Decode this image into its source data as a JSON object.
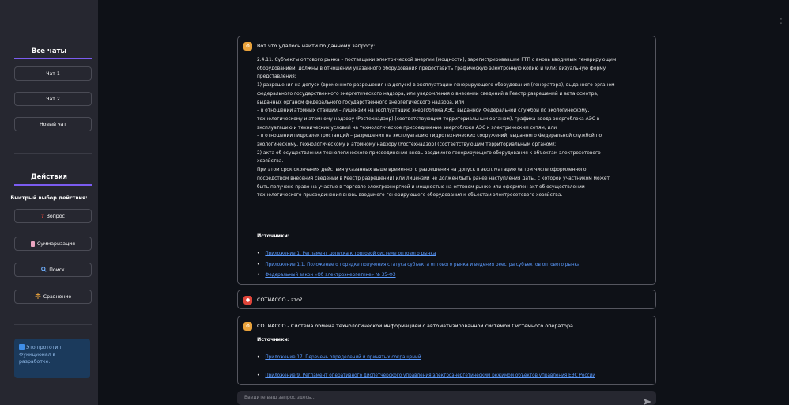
{
  "sidebar": {
    "chats_header": "Все чаты",
    "chats": [
      "Чат 1",
      "Чат 2",
      "Новый чат"
    ],
    "actions_header": "Действия",
    "quick_label": "Быстрый выбор действия:",
    "actions": [
      {
        "icon": "question-icon",
        "label": "Вопрос"
      },
      {
        "icon": "document-icon",
        "label": "Суммаризация"
      },
      {
        "icon": "search-icon",
        "label": "Поиск"
      },
      {
        "icon": "compare-icon",
        "label": "Сравнение"
      }
    ],
    "info": "Это прототип. Функционал в разработке."
  },
  "messages": [
    {
      "role": "assistant",
      "lead": "Вот что удалось найти по данному запросу:",
      "lines": [
        "2.4.11. Субъекты оптового рынка – поставщики электрической энергии (мощности), зарегистрировавшие ГТП с вновь вводимым генерирующим",
        "оборудованием, должны в отношении указанного оборудования предоставить графическую электронную копию и (или) визуальную форму",
        "представления:",
        "1) разрешения на допуск (временного разрешения на допуск) в эксплуатацию генерирующего оборудования (генератора), выданного органом",
        "федерального государственного энергетического надзора, или уведомления о внесении сведений в Реестр разрешений и акта осмотра,",
        "выданных органом федерального государственного энергетического надзора, или",
        "– в отношении атомных станций – лицензии на эксплуатацию энергоблока АЭС, выданной Федеральной службой по экологическому,",
        "технологическому и атомному надзору (Ростехнадзор) (соответствующим территориальным органом), графика ввода энергоблока АЭС в",
        "эксплуатацию и технических условий на технологическое присоединение энергоблока АЭС к электрическим сетям, или",
        "– в отношении гидроэлектростанций – разрешения на эксплуатацию гидротехнических сооружений, выданного Федеральной службой по",
        "экологическому, технологическому и атомному надзору (Ростехнадзор) (соответствующим территориальным органом);",
        "2) акта об осуществлении технологического присоединения вновь вводимого генерирующего оборудования к объектам электросетевого",
        "хозяйства.",
        "При этом срок окончания действия указанных выше временного разрешения на допуск в эксплуатацию (в том числе оформленного",
        "посредством внесения сведений в Реестр разрешений) или лицензии не должен быть ранее наступления даты, с которой участником может",
        "быть получено право на участие в торговле электроэнергией и мощностью на оптовом рынке или оформлен акт об осуществлении",
        "технологического присоединения вновь вводимого генерирующего оборудования к объектам электросетевого хозяйства."
      ],
      "sources_title": "Источники:",
      "sources": [
        "Приложение 1. Регламент допуска к торговой системе оптового рынка",
        "Приложение 1.1. Положение о порядке получения статуса субъекта оптового рынка и ведения реестра субъектов оптового рынка",
        "Федеральный закон «Об электроэнергетике» № 35-ФЗ"
      ]
    },
    {
      "role": "user",
      "lead": "СОТИАССО - это?"
    },
    {
      "role": "assistant",
      "lead": "СОТИАССО - Система обмена технологической информацией с автоматизированной системой Системного оператора",
      "sources_title": "Источники:",
      "sources": [
        "Приложение 17. Перечень определений и принятых сокращений",
        "Приложение 9. Регламент оперативного диспетчерского управления электроэнергетическим режимом объектов управления ЕЭС России"
      ]
    }
  ],
  "input": {
    "placeholder": "Введите ваш запрос здесь..."
  },
  "colors": {
    "accent": "#7b5cf0",
    "bot_avatar": "#e9a23b",
    "user_avatar": "#e0453a",
    "link": "#5b9bff"
  }
}
